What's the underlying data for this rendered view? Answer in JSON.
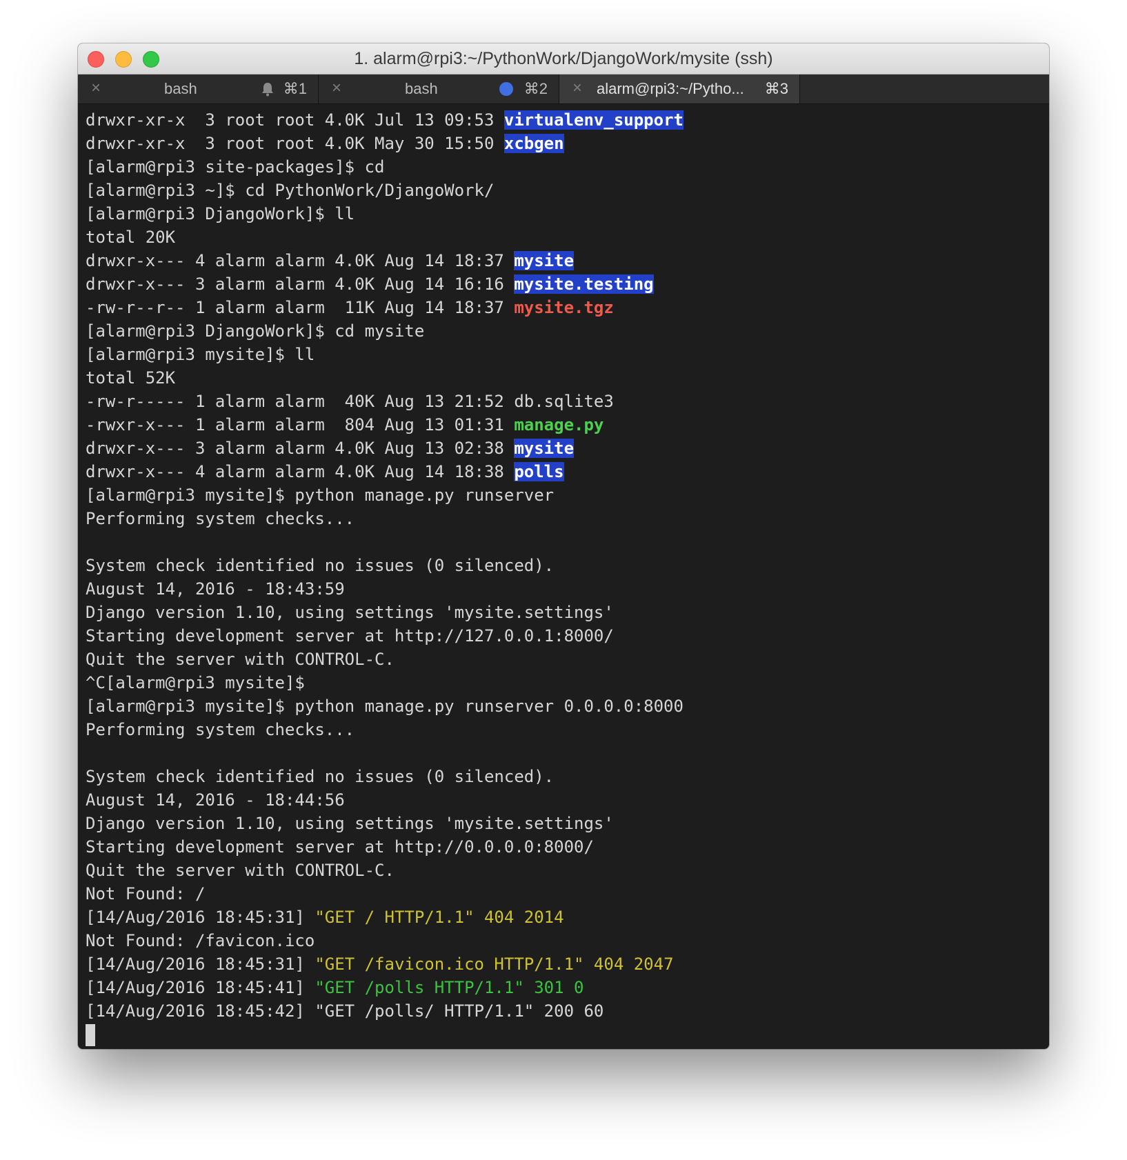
{
  "window": {
    "title": "1. alarm@rpi3:~/PythonWork/DjangoWork/mysite (ssh)"
  },
  "tabs": [
    {
      "label": "bash",
      "shortcut": "⌘1",
      "indicator": "bell-icon"
    },
    {
      "label": "bash",
      "shortcut": "⌘2",
      "indicator": "activity-dot"
    },
    {
      "label": "alarm@rpi3:~/Pytho...",
      "shortcut": "⌘3",
      "active": true
    }
  ],
  "colors": {
    "dir_highlight": "#2340c8",
    "archive_red": "#f05a4a",
    "executable_green": "#4cd24e",
    "log_yellow": "#cfc231",
    "log_green": "#3bc33f",
    "activity_dot": "#3f6fe0"
  },
  "terminal": {
    "lines": [
      {
        "pre": "drwxr-xr-x  3 root root 4.0K Jul 13 09:53 ",
        "name": "virtualenv_support"
      },
      {
        "pre": "drwxr-xr-x  3 root root 4.0K May 30 15:50 ",
        "name": "xcbgen"
      },
      {
        "text": "[alarm@rpi3 site-packages]$ cd"
      },
      {
        "text": "[alarm@rpi3 ~]$ cd PythonWork/DjangoWork/"
      },
      {
        "text": "[alarm@rpi3 DjangoWork]$ ll"
      },
      {
        "text": "total 20K"
      },
      {
        "pre": "drwxr-x--- 4 alarm alarm 4.0K Aug 14 18:37 ",
        "name": "mysite"
      },
      {
        "pre": "drwxr-x--- 3 alarm alarm 4.0K Aug 14 16:16 ",
        "name": "mysite.testing"
      },
      {
        "pre": "-rw-r--r-- 1 alarm alarm  11K Aug 14 18:37 ",
        "name": "mysite.tgz"
      },
      {
        "text": "[alarm@rpi3 DjangoWork]$ cd mysite"
      },
      {
        "text": "[alarm@rpi3 mysite]$ ll"
      },
      {
        "text": "total 52K"
      },
      {
        "pre": "-rw-r----- 1 alarm alarm  40K Aug 13 21:52 ",
        "name": "db.sqlite3"
      },
      {
        "pre": "-rwxr-x--- 1 alarm alarm  804 Aug 13 01:31 ",
        "name": "manage.py"
      },
      {
        "pre": "drwxr-x--- 3 alarm alarm 4.0K Aug 13 02:38 ",
        "name": "mysite"
      },
      {
        "pre": "drwxr-x--- 4 alarm alarm 4.0K Aug 14 18:38 ",
        "name": "polls"
      },
      {
        "text": "[alarm@rpi3 mysite]$ python manage.py runserver"
      },
      {
        "text": "Performing system checks..."
      },
      {
        "text": ""
      },
      {
        "text": "System check identified no issues (0 silenced)."
      },
      {
        "text": "August 14, 2016 - 18:43:59"
      },
      {
        "text": "Django version 1.10, using settings 'mysite.settings'"
      },
      {
        "text": "Starting development server at http://127.0.0.1:8000/"
      },
      {
        "text": "Quit the server with CONTROL-C."
      },
      {
        "text": "^C[alarm@rpi3 mysite]$"
      },
      {
        "text": "[alarm@rpi3 mysite]$ python manage.py runserver 0.0.0.0:8000"
      },
      {
        "text": "Performing system checks..."
      },
      {
        "text": ""
      },
      {
        "text": "System check identified no issues (0 silenced)."
      },
      {
        "text": "August 14, 2016 - 18:44:56"
      },
      {
        "text": "Django version 1.10, using settings 'mysite.settings'"
      },
      {
        "text": "Starting development server at http://0.0.0.0:8000/"
      },
      {
        "text": "Quit the server with CONTROL-C."
      },
      {
        "text": "Not Found: /"
      },
      {
        "pre": "[14/Aug/2016 18:45:31] ",
        "name": "\"GET / HTTP/1.1\" 404 2014"
      },
      {
        "text": "Not Found: /favicon.ico"
      },
      {
        "pre": "[14/Aug/2016 18:45:31] ",
        "name": "\"GET /favicon.ico HTTP/1.1\" 404 2047"
      },
      {
        "pre": "[14/Aug/2016 18:45:41] ",
        "name": "\"GET /polls HTTP/1.1\" 301 0"
      },
      {
        "text": "[14/Aug/2016 18:45:42] \"GET /polls/ HTTP/1.1\" 200 60"
      }
    ]
  }
}
